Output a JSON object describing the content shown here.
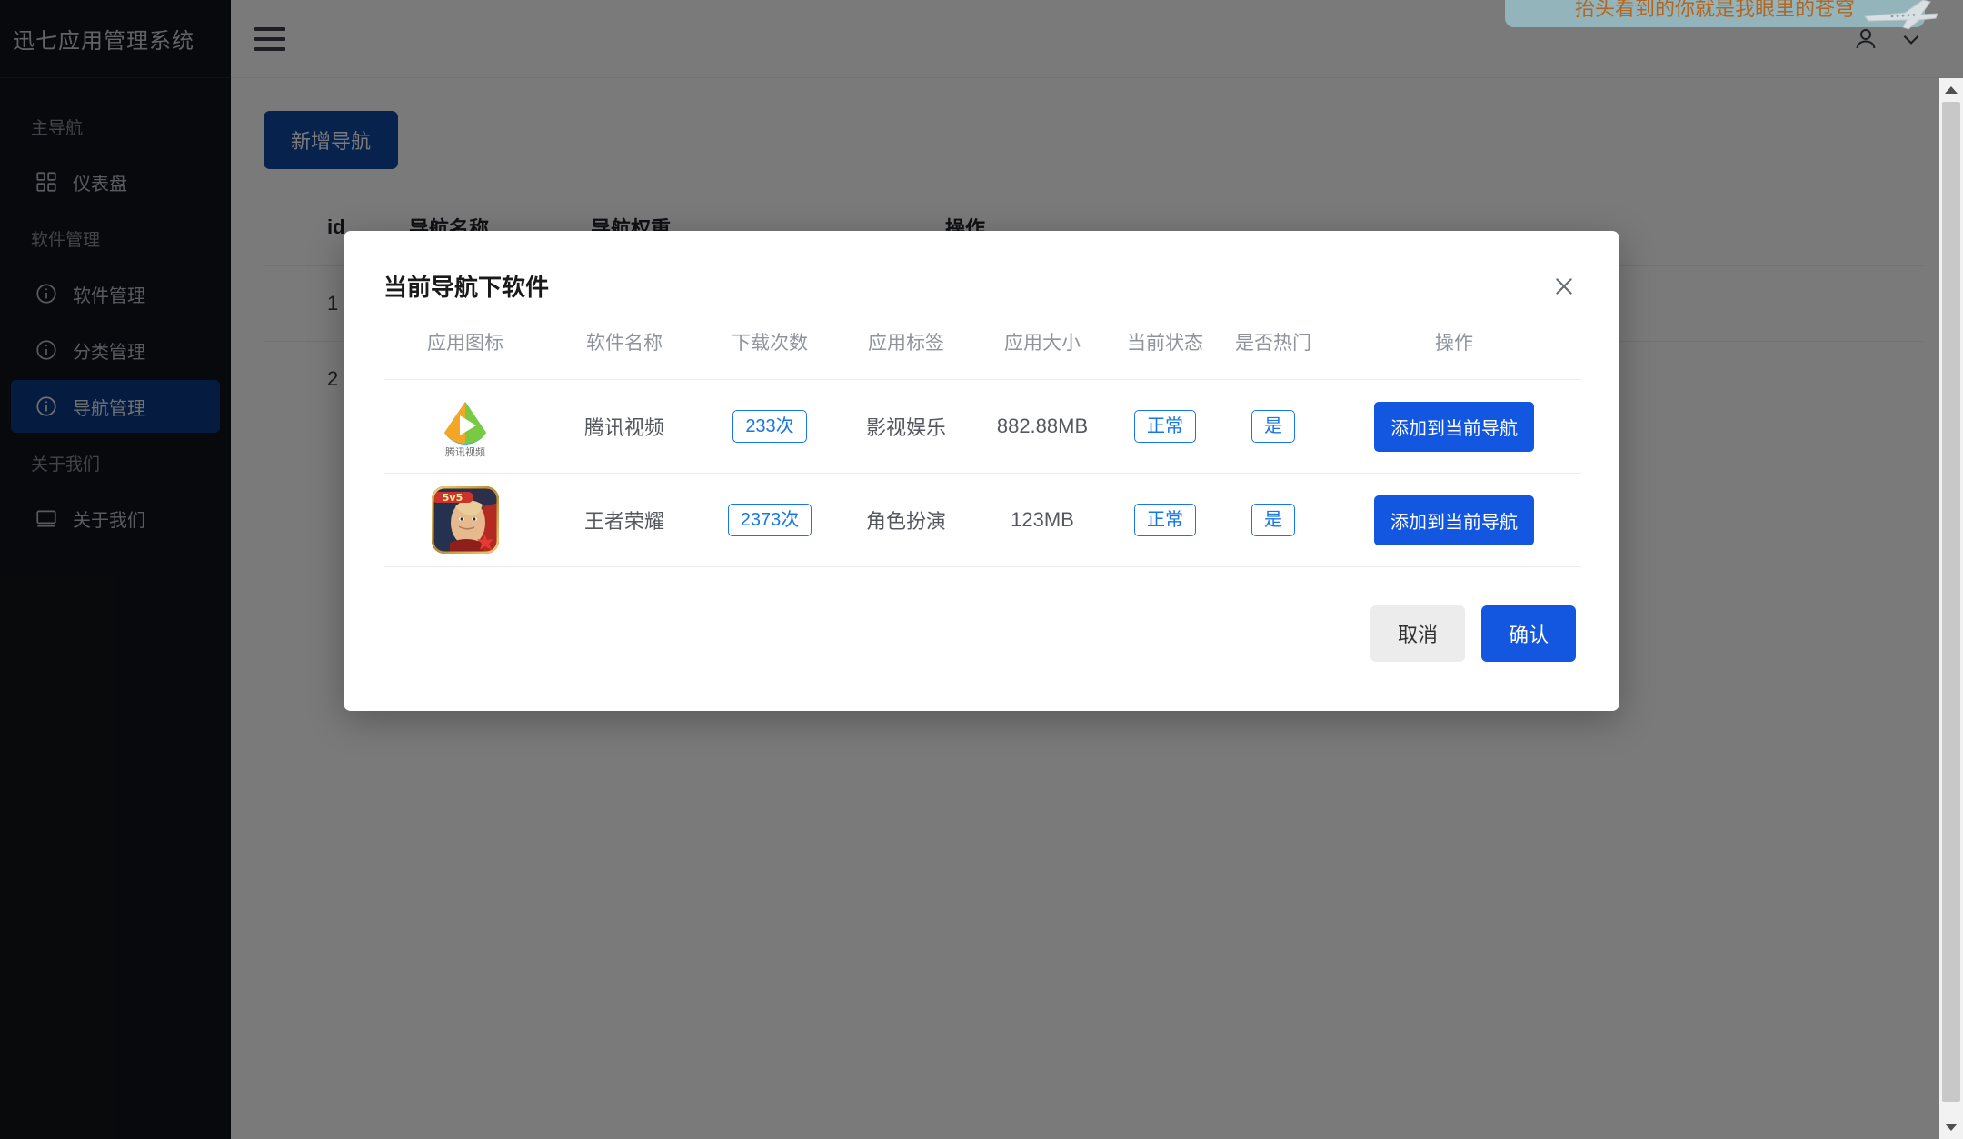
{
  "sidebar": {
    "brand": "迅七应用管理系统",
    "groups": [
      {
        "title": "主导航",
        "items": [
          {
            "label": "仪表盘",
            "icon": "dashboard-grid-icon",
            "active": false
          }
        ]
      },
      {
        "title": "软件管理",
        "items": [
          {
            "label": "软件管理",
            "icon": "info-circle-icon",
            "active": false
          },
          {
            "label": "分类管理",
            "icon": "info-circle-icon",
            "active": false
          },
          {
            "label": "导航管理",
            "icon": "info-circle-icon",
            "active": true
          }
        ]
      },
      {
        "title": "关于我们",
        "items": [
          {
            "label": "关于我们",
            "icon": "monitor-icon",
            "active": false
          }
        ]
      }
    ]
  },
  "topbar": {
    "menu_icon": "hamburger-menu-icon",
    "user_icon": "user-avatar-icon",
    "chevron_icon": "chevron-down-icon"
  },
  "toast": {
    "text": "抬头看到的你就是我眼里的苍穹",
    "icon": "airplane-icon",
    "text_color": "#b5651d",
    "background": "#96b9c1"
  },
  "page": {
    "add_button": "新增导航",
    "table": {
      "headers": [
        "id",
        "导航名称",
        "导航权重",
        "操作"
      ],
      "rows": [
        {
          "id": "1"
        },
        {
          "id": "2"
        }
      ]
    }
  },
  "modal": {
    "title": "当前导航下软件",
    "close_icon": "close-icon",
    "table": {
      "headers": [
        "应用图标",
        "软件名称",
        "下载次数",
        "应用标签",
        "应用大小",
        "当前状态",
        "是否热门",
        "操作"
      ],
      "rows": [
        {
          "icon": "tencent-video-app-icon",
          "icon_caption": "腾讯视频",
          "name": "腾讯视频",
          "downloads": "233次",
          "tag": "影视娱乐",
          "size": "882.88MB",
          "status": "正常",
          "hot": "是",
          "action": "添加到当前导航"
        },
        {
          "icon": "honor-of-kings-app-icon",
          "icon_caption": "5v5",
          "name": "王者荣耀",
          "downloads": "2373次",
          "tag": "角色扮演",
          "size": "123MB",
          "status": "正常",
          "hot": "是",
          "action": "添加到当前导航"
        }
      ]
    },
    "footer": {
      "cancel": "取消",
      "confirm": "确认"
    }
  },
  "colors": {
    "sidebar_bg": "#12141a",
    "sidebar_active": "#0b3a86",
    "primary_dark": "#0d47a1",
    "primary_blue": "#1356e0",
    "outline_blue": "#1677e8"
  }
}
